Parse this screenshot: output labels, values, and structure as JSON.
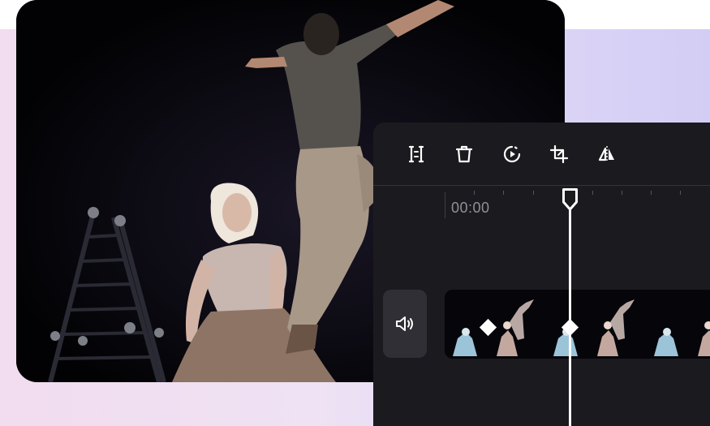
{
  "toolbar": {
    "tools": [
      {
        "name": "split",
        "icon": "split-icon"
      },
      {
        "name": "delete",
        "icon": "trash-icon"
      },
      {
        "name": "speed",
        "icon": "speed-icon"
      },
      {
        "name": "crop",
        "icon": "crop-icon"
      },
      {
        "name": "flip",
        "icon": "flip-icon"
      }
    ]
  },
  "timeline": {
    "timecode": "00:00"
  },
  "audio": {
    "icon": "volume-icon"
  },
  "colors": {
    "panel_bg": "#1b1b1f",
    "accent": "#ffffff",
    "background_gradient": [
      "#f2dcef",
      "#d3cdf5"
    ]
  }
}
